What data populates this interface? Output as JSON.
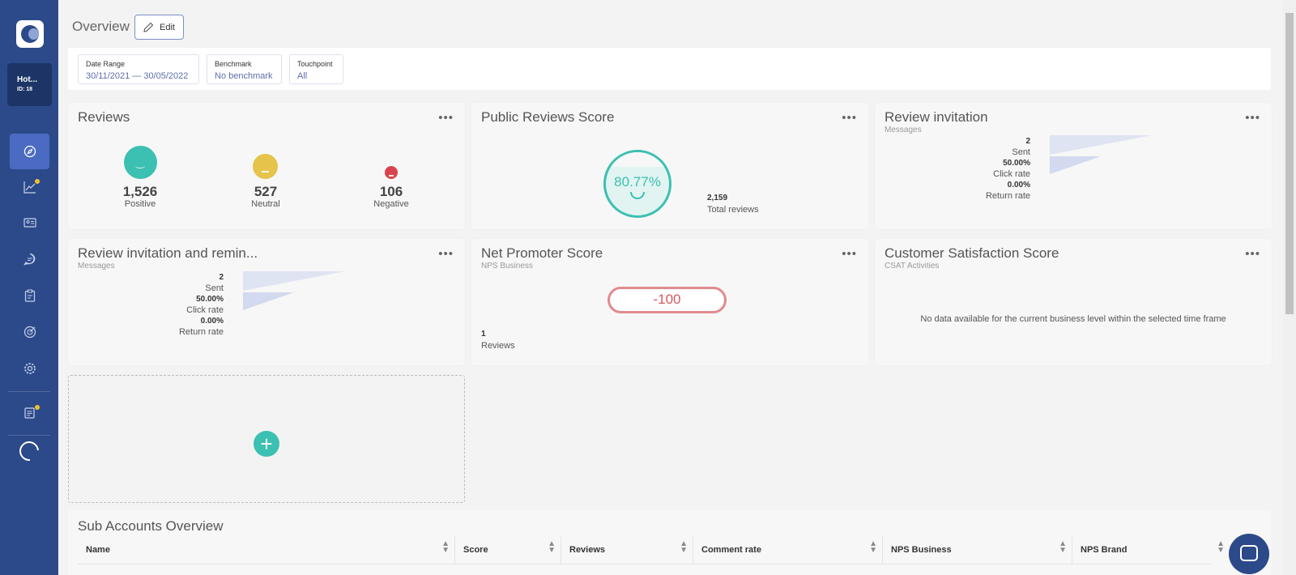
{
  "sidebar": {
    "account_name": "Hot...",
    "account_id": "ID: 18",
    "items": [
      {
        "icon": "compass-icon",
        "active": true
      },
      {
        "icon": "chart-icon",
        "badge": true
      },
      {
        "icon": "contact-card-icon"
      },
      {
        "icon": "chat-icon"
      },
      {
        "icon": "clipboard-icon"
      },
      {
        "icon": "target-icon"
      },
      {
        "icon": "gear-icon"
      },
      {
        "icon": "notes-icon",
        "badge": true
      }
    ]
  },
  "header": {
    "title": "Overview",
    "edit_label": "Edit"
  },
  "filters": [
    {
      "label": "Date Range",
      "value": "30/11/2021 — 30/05/2022"
    },
    {
      "label": "Benchmark",
      "value": "No benchmark"
    },
    {
      "label": "Touchpoint",
      "value": "All"
    }
  ],
  "cards": {
    "reviews": {
      "title": "Reviews",
      "positive": {
        "value": "1,526",
        "label": "Positive"
      },
      "neutral": {
        "value": "527",
        "label": "Neutral"
      },
      "negative": {
        "value": "106",
        "label": "Negative"
      }
    },
    "public_score": {
      "title": "Public Reviews Score",
      "score": "80.77%",
      "total_value": "2,159",
      "total_label": "Total reviews"
    },
    "review_invitation": {
      "title": "Review invitation",
      "subtitle": "Messages",
      "sent_value": "2",
      "sent_label": "Sent",
      "click_value": "50.00%",
      "click_label": "Click rate",
      "return_value": "0.00%",
      "return_label": "Return rate"
    },
    "invitation_reminder": {
      "title": "Review invitation and remin...",
      "subtitle": "Messages",
      "sent_value": "2",
      "sent_label": "Sent",
      "click_value": "50.00%",
      "click_label": "Click rate",
      "return_value": "0.00%",
      "return_label": "Return rate"
    },
    "nps": {
      "title": "Net Promoter Score",
      "subtitle": "NPS Business",
      "score": "-100",
      "reviews_value": "1",
      "reviews_label": "Reviews"
    },
    "csat": {
      "title": "Customer Satisfaction Score",
      "subtitle": "CSAT Activities",
      "message": "No data available for the current business level within the selected time frame"
    },
    "menu_glyph": "•••",
    "add_glyph": "+"
  },
  "sub_accounts": {
    "title": "Sub Accounts Overview",
    "columns": [
      "Name",
      "Score",
      "Reviews",
      "Comment rate",
      "NPS Business",
      "NPS Brand"
    ]
  },
  "colors": {
    "sidebar": "#2c4a8a",
    "positive": "#3cc0b1",
    "neutral": "#e6c34a",
    "negative": "#d9434b",
    "nps": "#e08a8e"
  }
}
